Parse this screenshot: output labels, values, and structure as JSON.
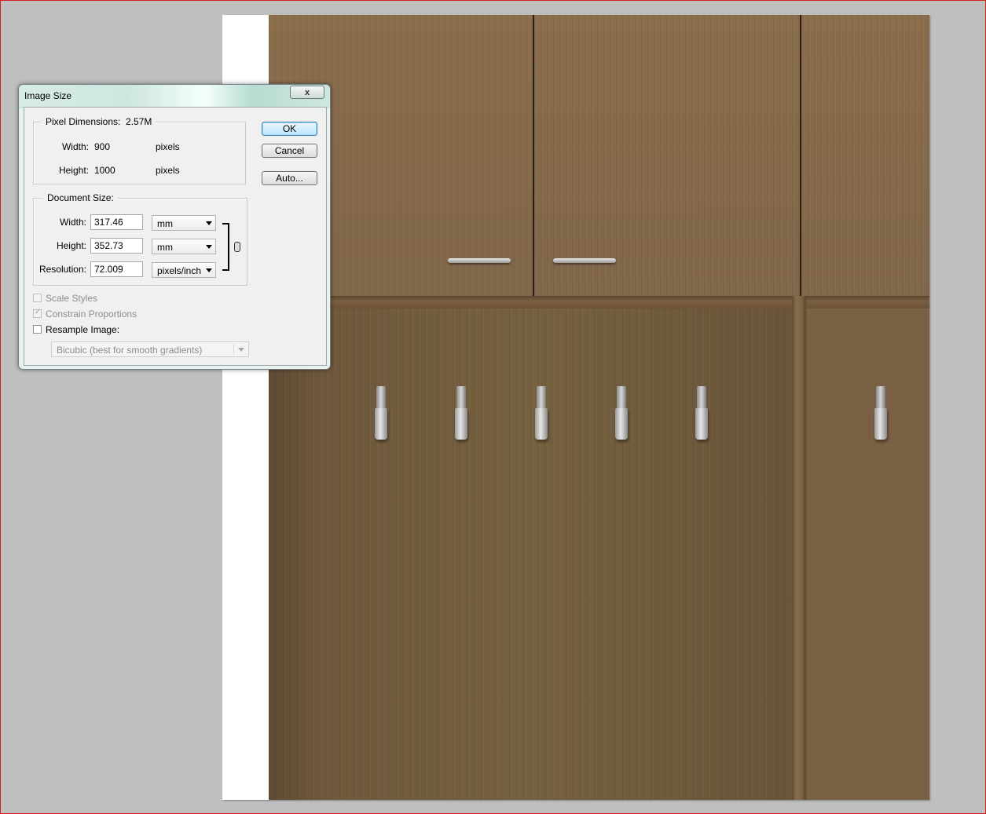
{
  "dialog": {
    "title": "Image Size",
    "close_glyph": "x",
    "pixel_dimensions": {
      "legend": "Pixel Dimensions:",
      "total": "2.57M",
      "width_label": "Width:",
      "width_value": "900",
      "width_unit": "pixels",
      "height_label": "Height:",
      "height_value": "1000",
      "height_unit": "pixels"
    },
    "document_size": {
      "legend": "Document Size:",
      "width_label": "Width:",
      "width_value": "317.46",
      "width_unit": "mm",
      "height_label": "Height:",
      "height_value": "352.73",
      "height_unit": "mm",
      "resolution_label": "Resolution:",
      "resolution_value": "72.009",
      "resolution_unit": "pixels/inch"
    },
    "buttons": {
      "ok": "OK",
      "cancel": "Cancel",
      "auto": "Auto..."
    },
    "options": {
      "scale_styles": {
        "label": "Scale Styles",
        "checked": false,
        "enabled": false
      },
      "constrain_proportions": {
        "label": "Constrain Proportions",
        "checked": true,
        "enabled": false
      },
      "resample_image": {
        "label": "Resample Image:",
        "checked": false,
        "enabled": true
      },
      "resample_method": "Bicubic (best for smooth gradients)"
    }
  },
  "colors": {
    "workspace": "#bfbfbf",
    "frame_border": "#d02020",
    "wood": "#7c6344",
    "ok_button_accent": "#3c7fb1"
  },
  "icons": {
    "chain": "chain-link-icon",
    "close": "close-icon",
    "dropdown": "chevron-down-icon"
  }
}
